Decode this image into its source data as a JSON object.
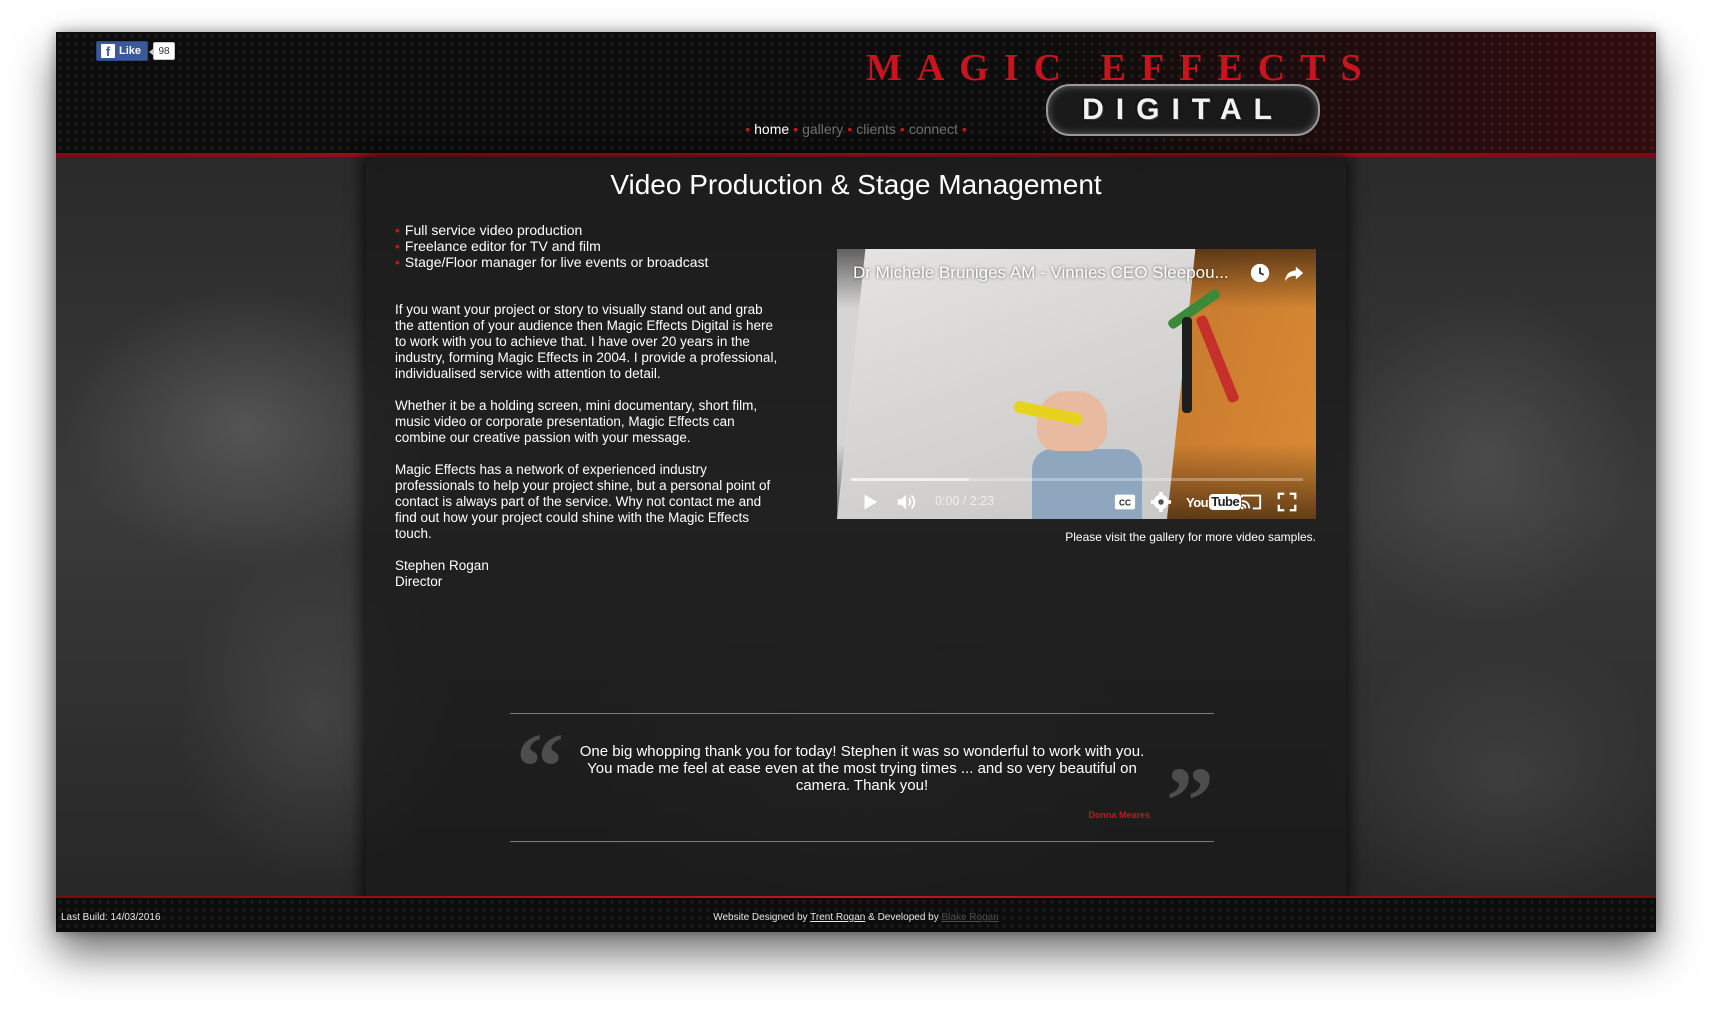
{
  "header": {
    "facebook": {
      "like_label": "Like",
      "like_count": "98"
    },
    "logo": {
      "top_text": "MAGIC EFFECTS",
      "bottom_text": "DIGITAL"
    },
    "nav": [
      {
        "label": "home",
        "active": true
      },
      {
        "label": "gallery",
        "active": false
      },
      {
        "label": "clients",
        "active": false
      },
      {
        "label": "connect",
        "active": false
      }
    ]
  },
  "main": {
    "title": "Video Production & Stage Management",
    "services": [
      "Full service video production",
      "Freelance editor for TV and film",
      "Stage/Floor manager for live events or broadcast"
    ],
    "paragraphs": [
      "If you want your project or story to visually stand out and grab the attention of your audience then Magic Effects Digital is here to work with you to achieve that. I have over 20 years in the industry, forming Magic Effects in 2004. I provide a professional, individualised service with attention to detail.",
      "Whether it be a holding screen, mini documentary, short film, music video or corporate presentation, Magic Effects can combine our creative passion with your message.",
      "Magic Effects has a network of experienced industry professionals to help your project shine, but a personal point of contact is always part of the service. Why not contact me and find out how your project could shine with the Magic Effects touch."
    ],
    "signature": {
      "name": "Stephen Rogan",
      "role": "Director"
    },
    "video": {
      "title": "Dr Michele Bruniges AM - Vinnies CEO Sleepou...",
      "time": "0:00 / 2:23",
      "loaded_fraction": 0.26,
      "youtube_label": {
        "you": "You",
        "tube": "Tube"
      }
    },
    "gallery_note": "Please visit the gallery for more video samples."
  },
  "testimonial": {
    "open_mark": "“",
    "close_mark": "”",
    "text": "One big whopping thank you for today! Stephen it was so wonderful to work with you. You made me feel at ease even at the most trying times ... and so very beautiful on camera. Thank you!",
    "author": "Donna Meares"
  },
  "footer": {
    "last_build": "Last Build: 14/03/2016",
    "credit_prefix": "Website Designed by",
    "designer": "Trent Rogan",
    "credit_middle": "& Developed by",
    "developer": "Blake Rogan"
  },
  "colors": {
    "accent_red": "#c9141e",
    "nav_inactive": "#6f6f6f",
    "facebook_blue": "#3b5998"
  },
  "icons": [
    "facebook-icon",
    "watch-later-icon",
    "share-icon",
    "play-icon",
    "volume-icon",
    "cc-icon",
    "settings-icon",
    "cast-icon",
    "fullscreen-icon"
  ]
}
